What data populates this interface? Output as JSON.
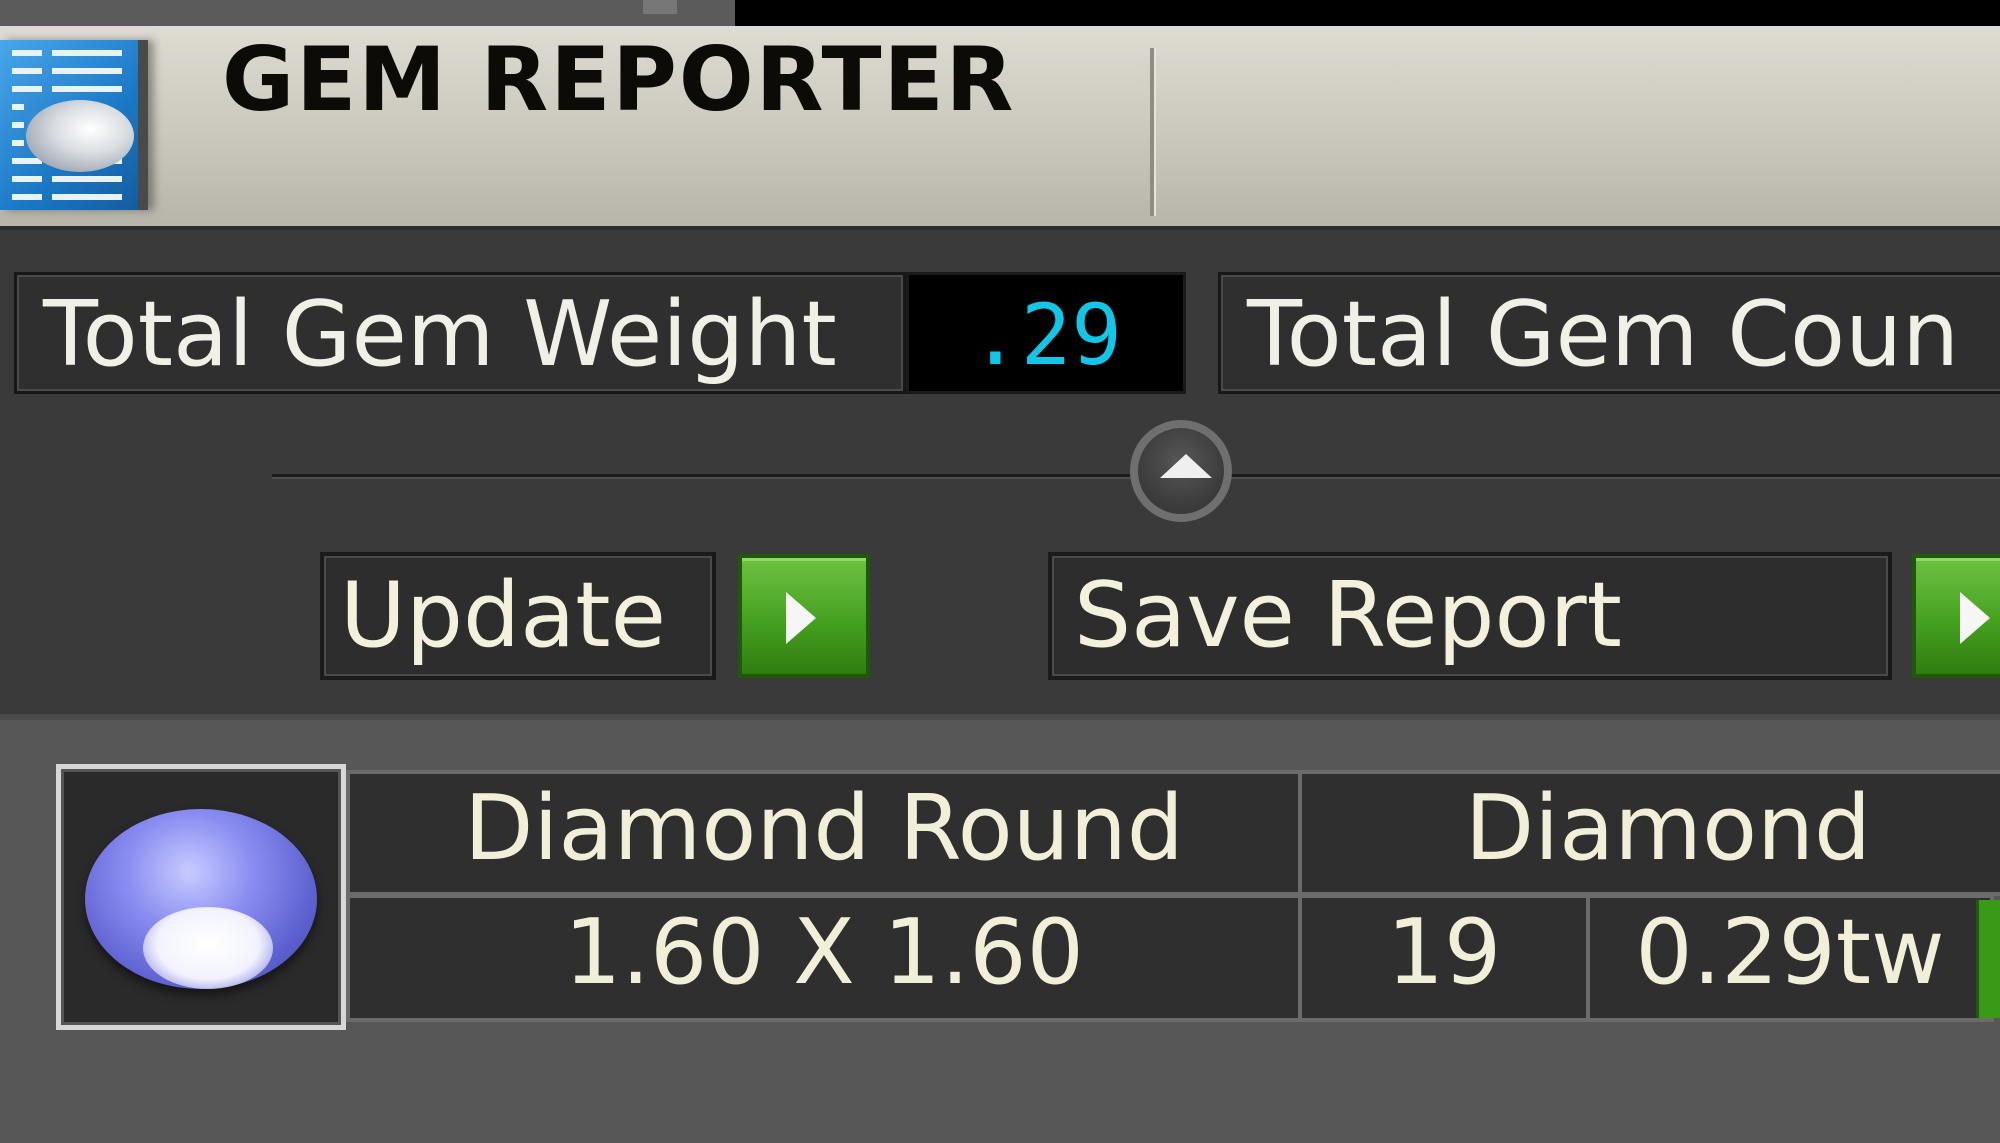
{
  "app": {
    "title": "GEM REPORTER",
    "icon": "report-gem-icon"
  },
  "summary": {
    "weight_label": "Total Gem Weight",
    "weight_value": ".29",
    "count_label": "Total Gem Coun"
  },
  "collapse": {
    "icon": "chevron-up-icon"
  },
  "actions": {
    "update_label": "Update",
    "save_label": "Save Report",
    "go_icon": "play-arrow-icon"
  },
  "gems": [
    {
      "name": "Diamond Round",
      "type": "Diamond",
      "size": "1.60 X 1.60",
      "count": "19",
      "weight": "0.29tw"
    }
  ],
  "colors": {
    "accent_value": "#12c6e8",
    "go_green": "#46a11f",
    "panel_bg": "#3a3a3a"
  }
}
